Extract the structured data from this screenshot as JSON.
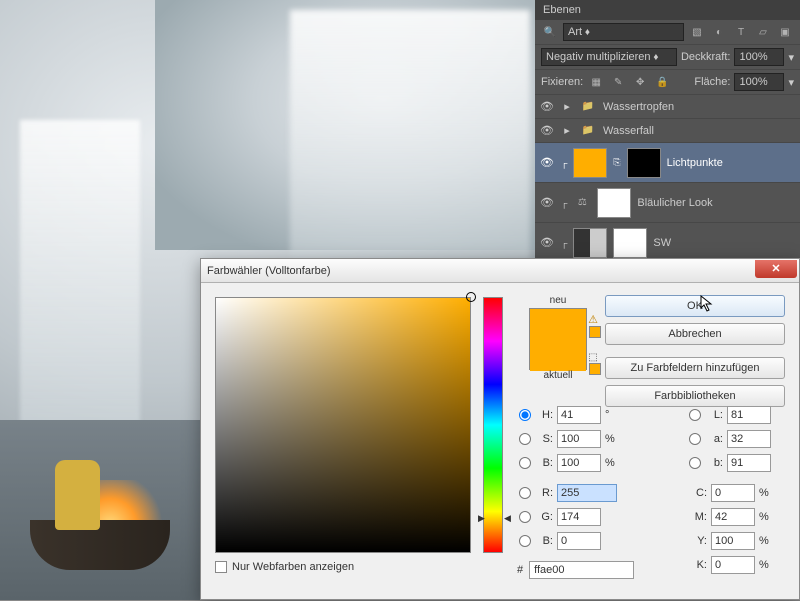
{
  "panel": {
    "title": "Ebenen",
    "filter_label": "Art",
    "blend_mode": "Negativ multiplizieren",
    "opacity_label": "Deckkraft:",
    "opacity_value": "100%",
    "fill_label": "Fläche:",
    "fill_value": "100%",
    "lock_label": "Fixieren:",
    "layers": [
      {
        "name": "Wassertropfen",
        "type": "group"
      },
      {
        "name": "Wasserfall",
        "type": "group"
      },
      {
        "name": "Lichtpunkte",
        "type": "adjust",
        "selected": true,
        "swatch": "orange"
      },
      {
        "name": "Bläulicher Look",
        "type": "adjust",
        "swatch": "white"
      },
      {
        "name": "SW",
        "type": "adjust",
        "swatch": "white"
      }
    ]
  },
  "dialog": {
    "title": "Farbwähler (Volltonfarbe)",
    "ok": "OK",
    "cancel": "Abbrechen",
    "add_swatch": "Zu Farbfeldern hinzufügen",
    "libraries": "Farbbibliotheken",
    "new_label": "neu",
    "current_label": "aktuell",
    "web_only": "Nur Webfarben anzeigen",
    "hex_prefix": "#",
    "hex_value": "ffae00",
    "hsb": {
      "H": "41",
      "S": "100",
      "B": "100"
    },
    "rgb": {
      "R": "255",
      "G": "174",
      "B": "0"
    },
    "lab": {
      "L": "81",
      "a": "32",
      "b": "91"
    },
    "cmyk": {
      "C": "0",
      "M": "42",
      "Y": "100",
      "K": "0"
    },
    "deg": "°",
    "pct": "%"
  }
}
